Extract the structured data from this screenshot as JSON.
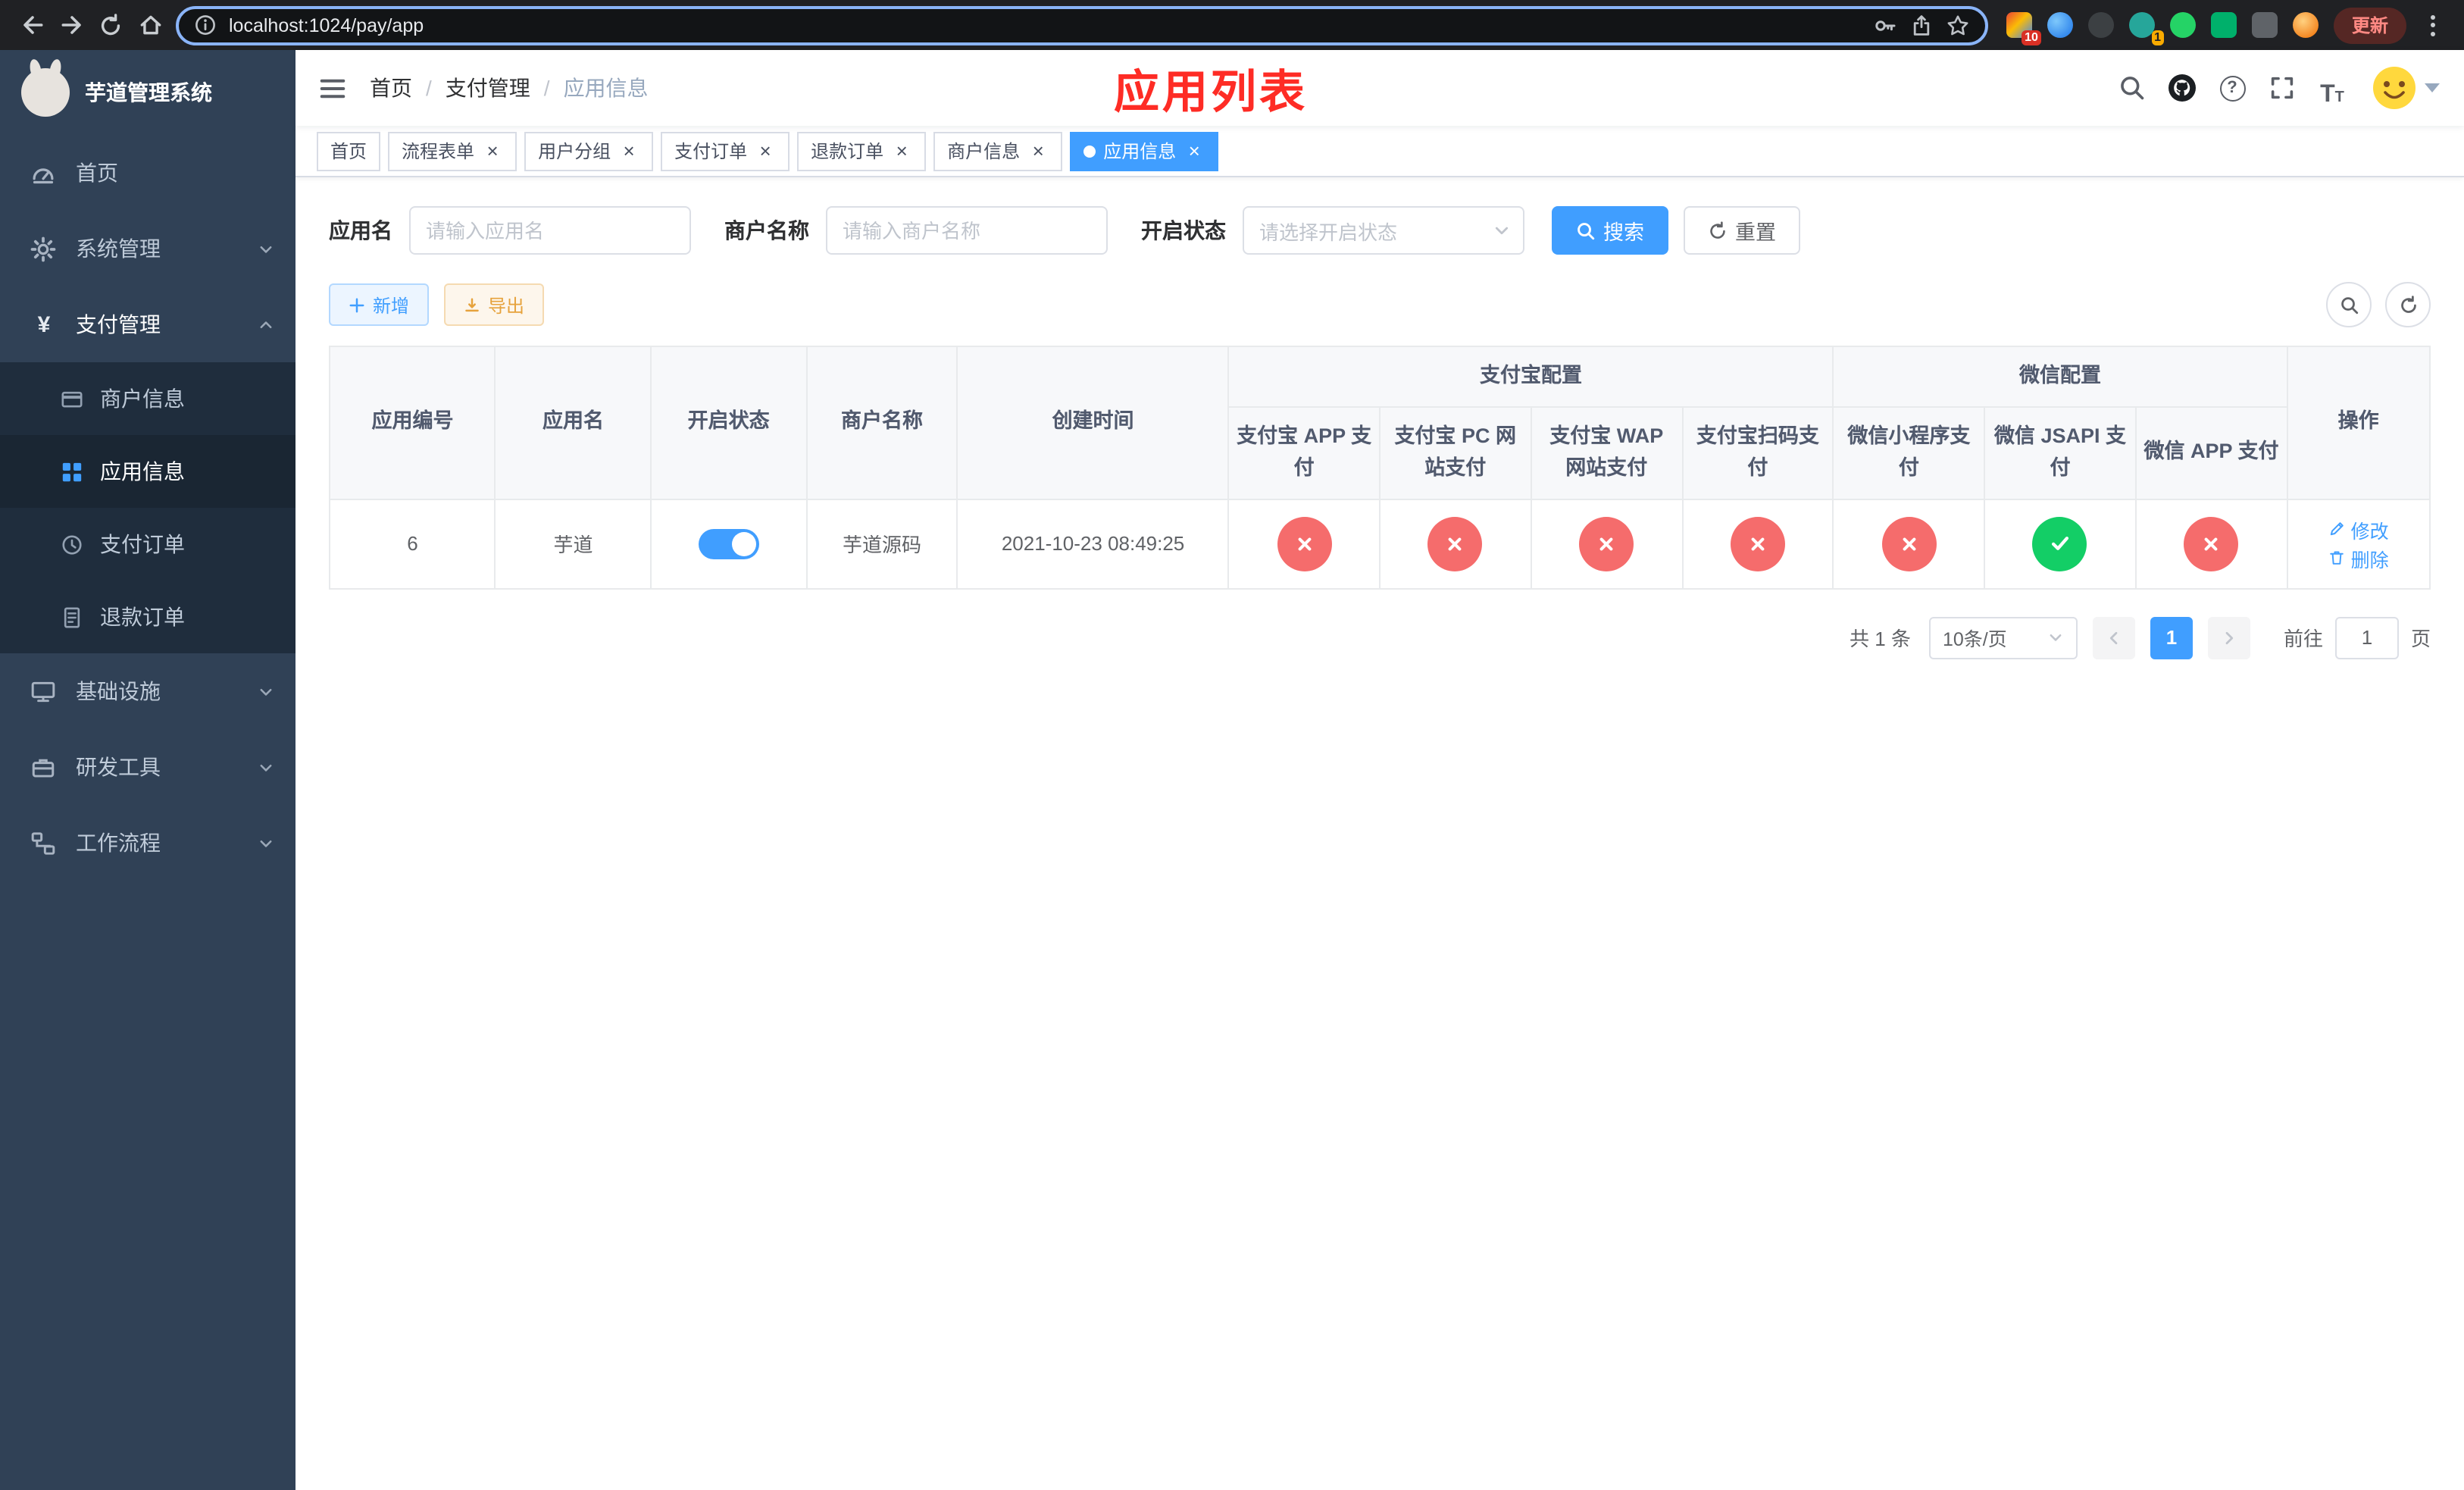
{
  "colors": {
    "primary": "#409eff",
    "danger": "#f56c6c",
    "success": "#13ce66",
    "warning": "#e6a23c",
    "annotation_red": "#fe2c25",
    "sidebar_bg": "#304156",
    "submenu_bg": "#1f2d3d"
  },
  "icons": {
    "close": "×",
    "question": "?",
    "yen": "¥",
    "font_large": "T",
    "font_small": "T"
  },
  "browser": {
    "url": "localhost:1024/pay/app",
    "update_label": "更新",
    "ext_badge_red": "10",
    "ext_badge_yellow": "1"
  },
  "sidebar": {
    "app_title": "芋道管理系统",
    "menu": [
      {
        "label": "首页"
      },
      {
        "label": "系统管理"
      },
      {
        "label": "支付管理"
      },
      {
        "label": "基础设施"
      },
      {
        "label": "研发工具"
      },
      {
        "label": "工作流程"
      }
    ],
    "pay_children": [
      {
        "label": "商户信息"
      },
      {
        "label": "应用信息"
      },
      {
        "label": "支付订单"
      },
      {
        "label": "退款订单"
      }
    ]
  },
  "header": {
    "breadcrumb": [
      "首页",
      "支付管理",
      "应用信息"
    ],
    "separator": "/",
    "annotation": "应用列表"
  },
  "tabs": [
    {
      "label": "首页"
    },
    {
      "label": "流程表单"
    },
    {
      "label": "用户分组"
    },
    {
      "label": "支付订单"
    },
    {
      "label": "退款订单"
    },
    {
      "label": "商户信息"
    },
    {
      "label": "应用信息"
    }
  ],
  "filters": {
    "app_name_label": "应用名",
    "app_name_placeholder": "请输入应用名",
    "merchant_label": "商户名称",
    "merchant_placeholder": "请输入商户名称",
    "status_label": "开启状态",
    "status_placeholder": "请选择开启状态",
    "search_label": "搜索",
    "reset_label": "重置"
  },
  "toolbar": {
    "add_label": "新增",
    "export_label": "导出"
  },
  "table": {
    "headers": {
      "app_id": "应用编号",
      "app_name": "应用名",
      "status": "开启状态",
      "merchant": "商户名称",
      "created": "创建时间",
      "alipay_group": "支付宝配置",
      "wechat_group": "微信配置",
      "alipay_app": "支付宝 APP 支付",
      "alipay_pc": "支付宝 PC 网站支付",
      "alipay_wap": "支付宝 WAP 网站支付",
      "alipay_qr": "支付宝扫码支付",
      "wx_mini": "微信小程序支付",
      "wx_jsapi": "微信 JSAPI 支付",
      "wx_app": "微信 APP 支付",
      "ops": "操作"
    },
    "rows": [
      {
        "app_id": "6",
        "app_name": "芋道",
        "enabled": true,
        "merchant": "芋道源码",
        "created": "2021-10-23 08:49:25",
        "configs": [
          "no",
          "no",
          "no",
          "no",
          "no",
          "yes",
          "no"
        ],
        "edit_label": "修改",
        "delete_label": "删除"
      }
    ]
  },
  "pagination": {
    "total": "共 1 条",
    "page_size": "10条/页",
    "page": "1",
    "jump_prefix": "前往",
    "jump_value": "1",
    "jump_suffix": "页"
  }
}
